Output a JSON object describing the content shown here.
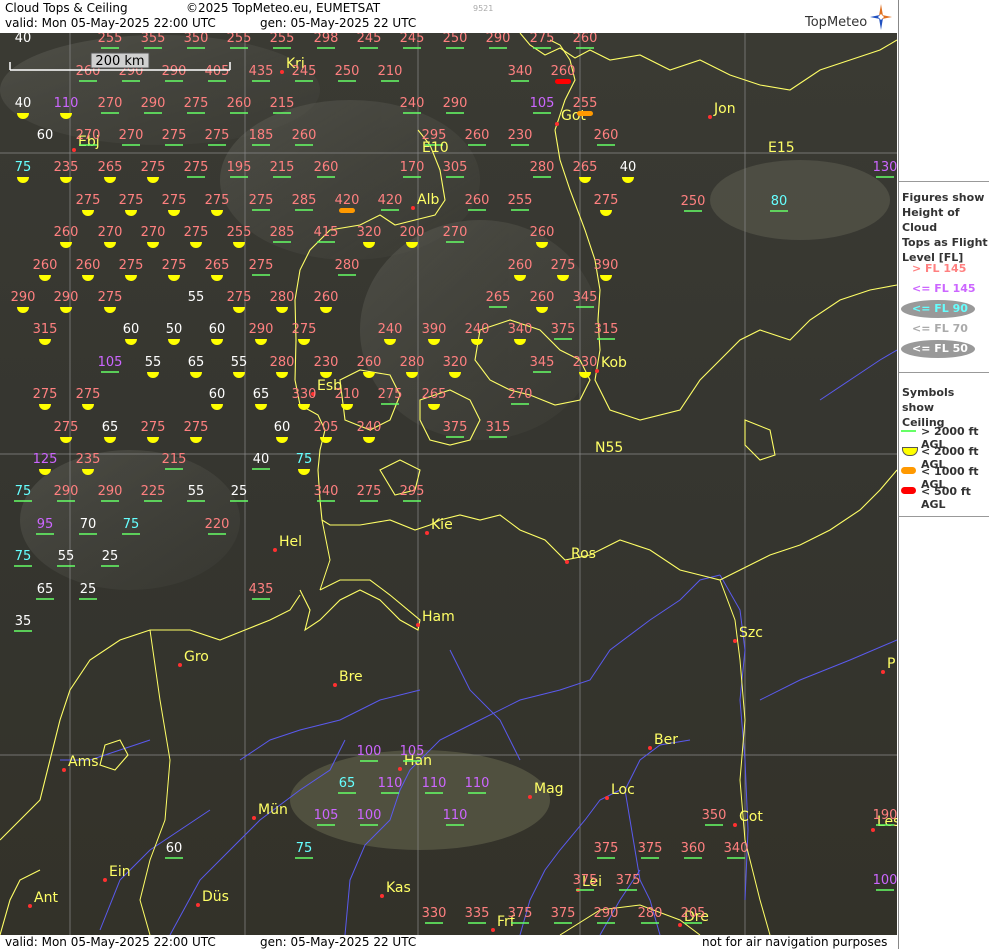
{
  "header": {
    "title": "Cloud Tops & Ceiling",
    "copyright": "©2025 TopMeteo.eu, EUMETSAT",
    "valid": "valid:  Mon  05-May-2025  22:00 UTC",
    "generated": "gen: 05-May-2025 22 UTC",
    "code": "9521",
    "brand": "TopMeteo"
  },
  "footer": {
    "valid": "valid:  Mon  05-May-2025  22:00 UTC",
    "generated": "gen: 05-May-2025 22 UTC",
    "disclaimer": "not for air navigation purposes"
  },
  "scale": {
    "label": "200 km"
  },
  "legend": {
    "figures_title": [
      "Figures show",
      "Height of Cloud",
      "Tops as Flight",
      "Level  [FL]"
    ],
    "levels": [
      {
        "label": "> FL 145",
        "color": "#ff8080",
        "oval": false
      },
      {
        "label": "<= FL 145",
        "color": "#cc66ff",
        "oval": false
      },
      {
        "label": "<= FL 90",
        "color": "#66ffff",
        "oval": true
      },
      {
        "label": "<= FL 70",
        "color": "#aaaaaa",
        "oval": false
      },
      {
        "label": "<= FL 50",
        "color": "#ffffff",
        "oval": true
      }
    ],
    "symbols_title": [
      "Symbols show",
      "Ceiling"
    ],
    "symbols": [
      {
        "label": "> 2000 ft AGL",
        "kind": "line",
        "color": "#66ff66"
      },
      {
        "label": "< 2000 ft AGL",
        "kind": "half",
        "color": "#ffff00"
      },
      {
        "label": "< 1000 ft AGL",
        "kind": "pill",
        "color": "#ff9900"
      },
      {
        "label": "< 500 ft AGL",
        "kind": "pill",
        "color": "#ff0000"
      }
    ]
  },
  "colors": {
    "high": "#ff8080",
    "mid": "#cc66ff",
    "low90": "#66ffff",
    "low70": "#ffffff",
    "coast": "#ffff66",
    "river": "#6666ff",
    "grid": "#888888"
  },
  "map_labels": {
    "grid": [
      "E10",
      "E15",
      "N55"
    ],
    "cities": [
      "Kri",
      "Got",
      "Jon",
      "Ebj",
      "Alb",
      "Esb",
      "Kob",
      "Kie",
      "Ros",
      "Hel",
      "Ham",
      "Szc",
      "Gro",
      "Bre",
      "Ams",
      "Han",
      "Ber",
      "Mün",
      "Mag",
      "Loc",
      "Cot",
      "Ein",
      "Düs",
      "Kas",
      "Lei",
      "Ant",
      "Frf",
      "Dre",
      "Les",
      "P"
    ]
  },
  "values": [
    [
      "40",
      "w",
      "none"
    ],
    [
      "255",
      "h",
      "line"
    ],
    [
      "355",
      "h",
      "line"
    ],
    [
      "350",
      "h",
      "line"
    ],
    [
      "255",
      "h",
      "line"
    ],
    [
      "255",
      "h",
      "line"
    ],
    [
      "298",
      "h",
      "line"
    ],
    [
      "245",
      "h",
      "line"
    ],
    [
      "245",
      "h",
      "line"
    ],
    [
      "250",
      "h",
      "line"
    ],
    [
      "290",
      "h",
      "line"
    ],
    [
      "275",
      "h",
      "line"
    ],
    [
      "260",
      "h",
      "line"
    ],
    [
      "260",
      "h",
      "line"
    ],
    [
      "290",
      "h",
      "line"
    ],
    [
      "290",
      "h",
      "line"
    ],
    [
      "405",
      "h",
      "line"
    ],
    [
      "435",
      "h",
      "line"
    ],
    [
      "245",
      "h",
      "line"
    ],
    [
      "250",
      "h",
      "line"
    ],
    [
      "210",
      "h",
      "line"
    ],
    [
      "340",
      "h",
      "line"
    ],
    [
      "260",
      "h",
      "red"
    ],
    [
      "40",
      "w",
      "half"
    ],
    [
      "110",
      "m",
      "half"
    ],
    [
      "270",
      "h",
      "line"
    ],
    [
      "290",
      "h",
      "line"
    ],
    [
      "275",
      "h",
      "line"
    ],
    [
      "260",
      "h",
      "line"
    ],
    [
      "215",
      "h",
      "line"
    ],
    [
      "240",
      "h",
      "line"
    ],
    [
      "290",
      "h",
      "line"
    ],
    [
      "105",
      "m",
      "line"
    ],
    [
      "255",
      "h",
      "orange"
    ],
    [
      "60",
      "w",
      "none"
    ],
    [
      "270",
      "h",
      "line"
    ],
    [
      "270",
      "h",
      "line"
    ],
    [
      "275",
      "h",
      "line"
    ],
    [
      "275",
      "h",
      "line"
    ],
    [
      "185",
      "h",
      "line"
    ],
    [
      "260",
      "h",
      "line"
    ],
    [
      "295",
      "h",
      "line"
    ],
    [
      "260",
      "h",
      "line"
    ],
    [
      "230",
      "h",
      "line"
    ],
    [
      "260",
      "h",
      "line"
    ],
    [
      "75",
      "c",
      "half"
    ],
    [
      "235",
      "h",
      "half"
    ],
    [
      "265",
      "h",
      "half"
    ],
    [
      "275",
      "h",
      "half"
    ],
    [
      "275",
      "h",
      "line"
    ],
    [
      "195",
      "h",
      "line"
    ],
    [
      "215",
      "h",
      "line"
    ],
    [
      "260",
      "h",
      "line"
    ],
    [
      "170",
      "h",
      "line"
    ],
    [
      "305",
      "h",
      "line"
    ],
    [
      "280",
      "h",
      "line"
    ],
    [
      "265",
      "h",
      "half"
    ],
    [
      "40",
      "w",
      "half"
    ],
    [
      "250",
      "h",
      "line"
    ],
    [
      "80",
      "c",
      "line"
    ],
    [
      "130",
      "m",
      "line"
    ],
    [
      "275",
      "h",
      "half"
    ],
    [
      "275",
      "h",
      "half"
    ],
    [
      "275",
      "h",
      "half"
    ],
    [
      "275",
      "h",
      "half"
    ],
    [
      "275",
      "h",
      "line"
    ],
    [
      "285",
      "h",
      "line"
    ],
    [
      "420",
      "h",
      "orange"
    ],
    [
      "420",
      "h",
      "line"
    ],
    [
      "260",
      "h",
      "line"
    ],
    [
      "255",
      "h",
      "line"
    ],
    [
      "275",
      "h",
      "half"
    ],
    [
      "260",
      "h",
      "half"
    ],
    [
      "270",
      "h",
      "half"
    ],
    [
      "270",
      "h",
      "half"
    ],
    [
      "275",
      "h",
      "half"
    ],
    [
      "255",
      "h",
      "half"
    ],
    [
      "285",
      "h",
      "line"
    ],
    [
      "415",
      "h",
      "line"
    ],
    [
      "320",
      "h",
      "half"
    ],
    [
      "200",
      "h",
      "half"
    ],
    [
      "270",
      "h",
      "line"
    ],
    [
      "260",
      "h",
      "half"
    ],
    [
      "260",
      "h",
      "half"
    ],
    [
      "260",
      "h",
      "half"
    ],
    [
      "275",
      "h",
      "half"
    ],
    [
      "275",
      "h",
      "half"
    ],
    [
      "265",
      "h",
      "half"
    ],
    [
      "275",
      "h",
      "line"
    ],
    [
      "280",
      "h",
      "line"
    ],
    [
      "260",
      "h",
      "half"
    ],
    [
      "275",
      "h",
      "half"
    ],
    [
      "390",
      "h",
      "half"
    ],
    [
      "290",
      "h",
      "half"
    ],
    [
      "290",
      "h",
      "half"
    ],
    [
      "275",
      "h",
      "half"
    ],
    [
      "55",
      "w",
      "none"
    ],
    [
      "275",
      "h",
      "half"
    ],
    [
      "280",
      "h",
      "half"
    ],
    [
      "260",
      "h",
      "half"
    ],
    [
      "265",
      "h",
      "line"
    ],
    [
      "260",
      "h",
      "half"
    ],
    [
      "345",
      "h",
      "line"
    ],
    [
      "315",
      "h",
      "half"
    ],
    [
      "60",
      "w",
      "half"
    ],
    [
      "50",
      "w",
      "half"
    ],
    [
      "60",
      "w",
      "half"
    ],
    [
      "290",
      "h",
      "half"
    ],
    [
      "275",
      "h",
      "half"
    ],
    [
      "240",
      "h",
      "half"
    ],
    [
      "390",
      "h",
      "half"
    ],
    [
      "240",
      "h",
      "half"
    ],
    [
      "340",
      "h",
      "half"
    ],
    [
      "375",
      "h",
      "line"
    ],
    [
      "315",
      "h",
      "line"
    ],
    [
      "105",
      "m",
      "line"
    ],
    [
      "55",
      "w",
      "half"
    ],
    [
      "65",
      "w",
      "half"
    ],
    [
      "55",
      "w",
      "half"
    ],
    [
      "280",
      "h",
      "half"
    ],
    [
      "230",
      "h",
      "half"
    ],
    [
      "260",
      "h",
      "half"
    ],
    [
      "280",
      "h",
      "half"
    ],
    [
      "320",
      "h",
      "half"
    ],
    [
      "345",
      "h",
      "line"
    ],
    [
      "230",
      "h",
      "half"
    ],
    [
      "275",
      "h",
      "half"
    ],
    [
      "275",
      "h",
      "half"
    ],
    [
      "60",
      "w",
      "half"
    ],
    [
      "65",
      "w",
      "half"
    ],
    [
      "330",
      "h",
      "half"
    ],
    [
      "210",
      "h",
      "half"
    ],
    [
      "275",
      "h",
      "line"
    ],
    [
      "265",
      "h",
      "half"
    ],
    [
      "270",
      "h",
      "line"
    ],
    [
      "275",
      "h",
      "half"
    ],
    [
      "65",
      "w",
      "half"
    ],
    [
      "275",
      "h",
      "half"
    ],
    [
      "275",
      "h",
      "half"
    ],
    [
      "60",
      "w",
      "half"
    ],
    [
      "205",
      "h",
      "half"
    ],
    [
      "240",
      "h",
      "half"
    ],
    [
      "375",
      "h",
      "line"
    ],
    [
      "315",
      "h",
      "line"
    ],
    [
      "125",
      "m",
      "half"
    ],
    [
      "235",
      "h",
      "half"
    ],
    [
      "215",
      "h",
      "line"
    ],
    [
      "40",
      "w",
      "line"
    ],
    [
      "75",
      "c",
      "half"
    ],
    [
      "75",
      "c",
      "line"
    ],
    [
      "290",
      "h",
      "line"
    ],
    [
      "290",
      "h",
      "line"
    ],
    [
      "225",
      "h",
      "line"
    ],
    [
      "55",
      "w",
      "line"
    ],
    [
      "25",
      "w",
      "line"
    ],
    [
      "340",
      "h",
      "line"
    ],
    [
      "275",
      "h",
      "line"
    ],
    [
      "295",
      "h",
      "line"
    ],
    [
      "95",
      "m",
      "line"
    ],
    [
      "70",
      "w",
      "line"
    ],
    [
      "75",
      "c",
      "line"
    ],
    [
      "220",
      "h",
      "line"
    ],
    [
      "75",
      "c",
      "line"
    ],
    [
      "55",
      "w",
      "line"
    ],
    [
      "25",
      "w",
      "line"
    ],
    [
      "65",
      "w",
      "line"
    ],
    [
      "25",
      "w",
      "line"
    ],
    [
      "435",
      "h",
      "line"
    ],
    [
      "35",
      "w",
      "line"
    ],
    [
      "100",
      "m",
      "line"
    ],
    [
      "105",
      "m",
      "line"
    ],
    [
      "65",
      "c",
      "line"
    ],
    [
      "110",
      "m",
      "line"
    ],
    [
      "110",
      "m",
      "line"
    ],
    [
      "110",
      "m",
      "line"
    ],
    [
      "105",
      "m",
      "line"
    ],
    [
      "100",
      "m",
      "line"
    ],
    [
      "110",
      "m",
      "line"
    ],
    [
      "350",
      "h",
      "line"
    ],
    [
      "190",
      "h",
      "line"
    ],
    [
      "60",
      "w",
      "line"
    ],
    [
      "75",
      "c",
      "line"
    ],
    [
      "375",
      "h",
      "line"
    ],
    [
      "375",
      "h",
      "line"
    ],
    [
      "360",
      "h",
      "line"
    ],
    [
      "340",
      "h",
      "line"
    ],
    [
      "375",
      "h",
      "line"
    ],
    [
      "375",
      "h",
      "line"
    ],
    [
      "100",
      "m",
      "line"
    ],
    [
      "330",
      "h",
      "line"
    ],
    [
      "335",
      "h",
      "line"
    ],
    [
      "375",
      "h",
      "line"
    ],
    [
      "375",
      "h",
      "line"
    ],
    [
      "290",
      "h",
      "line"
    ],
    [
      "280",
      "h",
      "line"
    ],
    [
      "205",
      "h",
      "line"
    ]
  ]
}
